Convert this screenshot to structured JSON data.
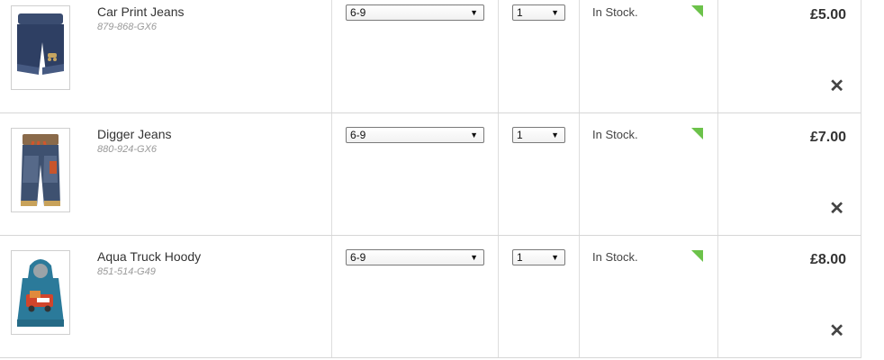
{
  "basket": {
    "items": [
      {
        "name": "Car Print Jeans",
        "code": "879-868-GX6",
        "size": "6-9",
        "quantity": "1",
        "stock": "In Stock.",
        "price": "£5.00",
        "remove_label": "✕",
        "image_icon": "car-print-jeans-image",
        "colors": {
          "main": "#2e3f63",
          "accent": "#465a82"
        }
      },
      {
        "name": "Digger Jeans",
        "code": "880-924-GX6",
        "size": "6-9",
        "quantity": "1",
        "stock": "In Stock.",
        "price": "£7.00",
        "remove_label": "✕",
        "image_icon": "digger-jeans-image",
        "colors": {
          "main": "#3e5170",
          "accent": "#c8552c"
        }
      },
      {
        "name": "Aqua Truck Hoody",
        "code": "851-514-G49",
        "size": "6-9",
        "quantity": "1",
        "stock": "In Stock.",
        "price": "£8.00",
        "remove_label": "✕",
        "image_icon": "aqua-truck-hoody-image",
        "colors": {
          "main": "#2b7a9a",
          "accent": "#d2452c"
        }
      }
    ],
    "stock_flag_color": "#6cc24a"
  }
}
